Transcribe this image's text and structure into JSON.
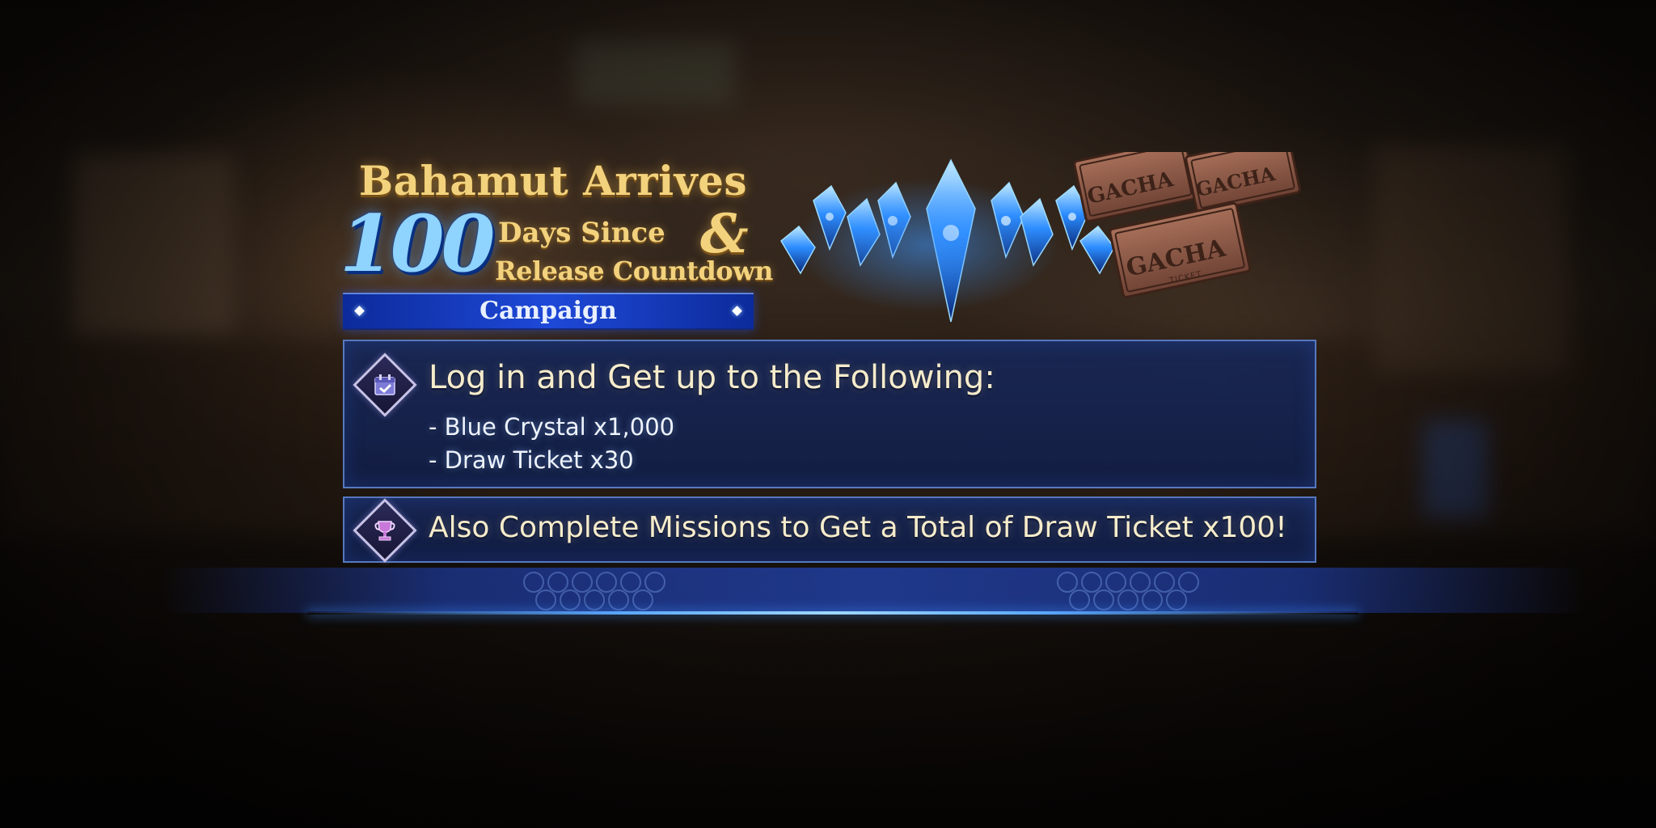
{
  "title": {
    "line1": "Bahamut Arrives",
    "number": "100",
    "days": "Days Since",
    "amp": "&",
    "release": "Release Countdown",
    "campaign": "Campaign"
  },
  "tickets": {
    "label": "GACHA",
    "sub": "TICKET"
  },
  "login_panel": {
    "icon": "calendar-check-icon",
    "heading": "Log in and Get up to the Following:",
    "items": [
      "- Blue Crystal x1,000",
      "- Draw Ticket x30"
    ]
  },
  "missions_panel": {
    "icon": "trophy-icon",
    "heading": "Also Complete Missions to Get a Total of Draw Ticket x100!"
  },
  "colors": {
    "gold": "#f3d27d",
    "blue_accent": "#1e49d8",
    "panel": "#16285c",
    "crystal": "#2b8cff"
  }
}
